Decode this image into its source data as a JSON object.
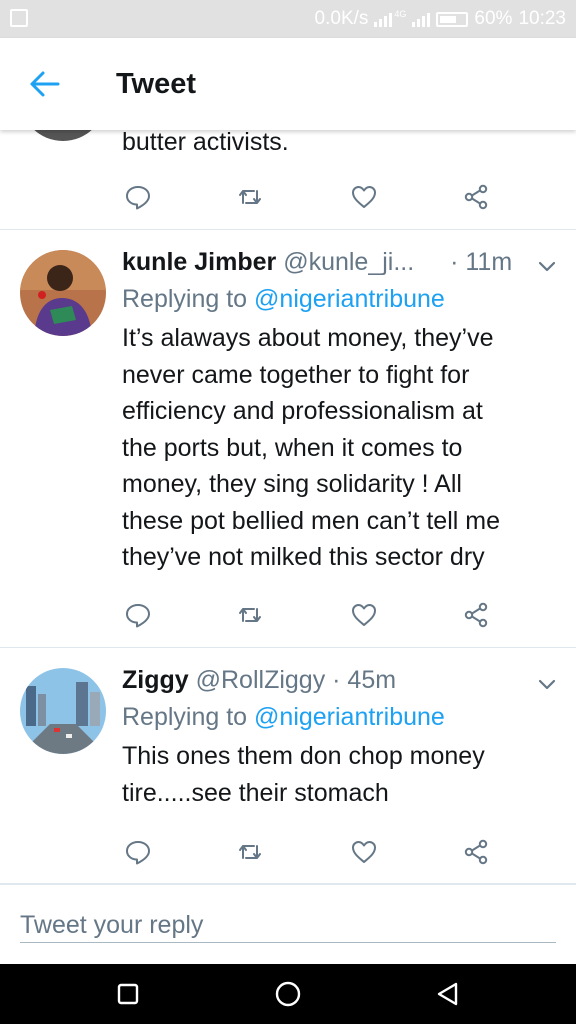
{
  "status_bar": {
    "speed": "0.0K/s",
    "network": "4G",
    "battery": "60%",
    "time": "10:23"
  },
  "header": {
    "title": "Tweet",
    "back_icon": "arrow-left-icon"
  },
  "colors": {
    "accent": "#1da1f2",
    "text": "#14171a",
    "secondary": "#657786",
    "divider": "#e1e8ed"
  },
  "tweets": [
    {
      "body_tail": "butter activists."
    },
    {
      "name": "kunle Jimber",
      "handle": "@kunle_ji...",
      "time": "· 11m",
      "replying_prefix": "Replying to ",
      "replying_to": "@nigeriantribune",
      "body_lines": [
        "It’s alaways about money, they’ve",
        "never came together to fight for",
        "efficiency and professionalism at",
        "the ports but, when it comes to",
        "money, they sing solidarity !  All",
        "these pot bellied men can’t tell me",
        "they’ve not milked this sector dry"
      ]
    },
    {
      "name": "Ziggy",
      "handle": "@RollZiggy",
      "time": "· 45m",
      "replying_prefix": "Replying to ",
      "replying_to": "@nigeriantribune",
      "body_lines": [
        "This ones them don chop money",
        "tire.....see their stomach"
      ]
    }
  ],
  "action_icons": [
    "reply-icon",
    "retweet-icon",
    "like-icon",
    "share-icon"
  ],
  "composer": {
    "placeholder": "Tweet your reply"
  },
  "nav_icons": [
    "recents-icon",
    "home-icon",
    "back-icon"
  ]
}
